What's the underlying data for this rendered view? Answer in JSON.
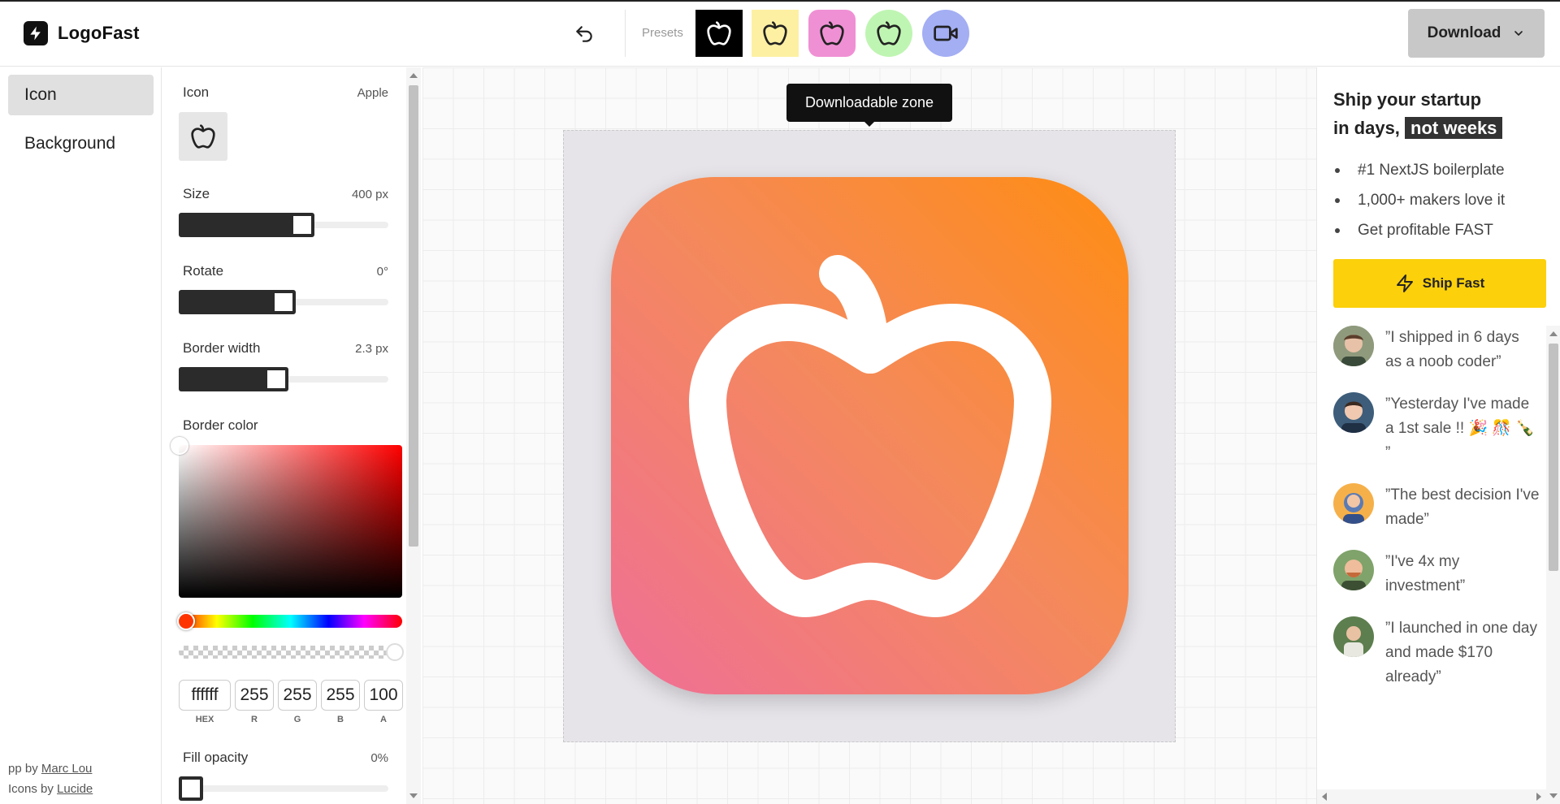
{
  "header": {
    "brand": "LogoFast",
    "presets_label": "Presets",
    "download_label": "Download",
    "presets": [
      {
        "name": "preset-black",
        "bg": "#000000",
        "fg": "#ffffff",
        "icon": "apple-icon",
        "shape": "square"
      },
      {
        "name": "preset-yellow",
        "bg": "#fef0a3",
        "fg": "#222222",
        "icon": "apple-icon",
        "shape": "square"
      },
      {
        "name": "preset-pink",
        "bg": "#f090d4",
        "fg": "#222222",
        "icon": "apple-icon",
        "shape": "rounded"
      },
      {
        "name": "preset-green",
        "bg": "#bff5b2",
        "fg": "#222222",
        "icon": "apple-icon",
        "shape": "circle"
      },
      {
        "name": "preset-purple",
        "bg": "#a3aef3",
        "fg": "#222222",
        "icon": "video-icon",
        "shape": "circle"
      }
    ]
  },
  "nav": {
    "items": [
      {
        "label": "Icon",
        "active": true
      },
      {
        "label": "Background",
        "active": false
      }
    ],
    "credits_app": "pp by",
    "credits_app_author": "Marc Lou",
    "credits_icons": "Icons by",
    "credits_icons_author": "Lucide"
  },
  "panel": {
    "icon_label": "Icon",
    "icon_value": "Apple",
    "size_label": "Size",
    "size_value": "400 px",
    "size_fraction": 0.6,
    "rotate_label": "Rotate",
    "rotate_value": "0°",
    "rotate_fraction": 0.5,
    "border_width_label": "Border width",
    "border_width_value": "2.3 px",
    "border_width_fraction": 0.46,
    "border_color_label": "Border color",
    "hex": "ffffff",
    "r": "255",
    "g": "255",
    "b": "255",
    "a": "100",
    "hex_cap": "HEX",
    "r_cap": "R",
    "g_cap": "G",
    "b_cap": "B",
    "a_cap": "A",
    "fill_opacity_label": "Fill opacity",
    "fill_opacity_value": "0%",
    "fill_opacity_fraction": 0
  },
  "canvas": {
    "tooltip": "Downloadable zone",
    "icon": "apple-icon",
    "gradient": [
      "#ff8c12",
      "#ef6f97"
    ]
  },
  "promo": {
    "title_line1": "Ship your startup",
    "title_line2_prefix": "in days,",
    "title_highlight": "not weeks",
    "bullets": [
      "#1 NextJS boilerplate",
      "1,000+ makers love it",
      "Get profitable FAST"
    ],
    "cta": "Ship Fast",
    "cta_color": "#fcd00b",
    "testimonials": [
      {
        "quote": "”I shipped in 6 days as a noob coder”"
      },
      {
        "quote": "”Yesterday I've made a 1st sale !! 🎉 🎊 🍾 ”"
      },
      {
        "quote": "”The best decision I've made”"
      },
      {
        "quote": "”I've 4x my investment”"
      },
      {
        "quote": "”I launched in one day and made $170 already”"
      }
    ]
  }
}
